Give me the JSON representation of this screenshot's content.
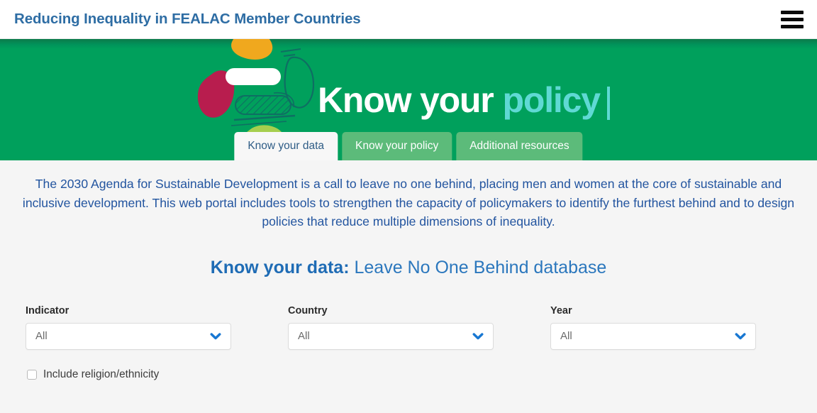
{
  "header": {
    "title": "Reducing Inequality in FEALAC Member Countries",
    "menu_icon": "hamburger-menu-icon"
  },
  "banner": {
    "logo": {
      "word_primary": "Know your",
      "word_accent": "policy",
      "caret": "|"
    },
    "colors": {
      "green": "#00a05c",
      "green_dark": "#0c7a4a",
      "accent_cyan": "#5fd9d4",
      "blob_orange": "#f0a81e",
      "blob_crimson": "#b81d4e",
      "blob_lightgreen": "#a6ce4e",
      "blob_white": "#ffffff",
      "blob_teal_outline": "#0f6e63"
    }
  },
  "tabs": [
    {
      "label": "Know your data",
      "active": true
    },
    {
      "label": "Know your policy",
      "active": false
    },
    {
      "label": "Additional resources",
      "active": false
    }
  ],
  "main": {
    "intro_paragraph": "The 2030 Agenda for Sustainable Development is a call to leave no one behind, placing men and women at the core of sustainable and inclusive development. This web portal includes tools to strengthen the capacity of policymakers to identify the furthest behind and to design policies that reduce multiple dimensions of inequality.",
    "section_heading_bold": "Know your data:",
    "section_heading_rest": " Leave No One Behind database",
    "filters": [
      {
        "label": "Indicator",
        "value": "All",
        "icon": "chevron-down-icon"
      },
      {
        "label": "Country",
        "value": "All",
        "icon": "chevron-down-icon"
      },
      {
        "label": "Year",
        "value": "All",
        "icon": "chevron-down-icon"
      }
    ],
    "checkbox": {
      "label": "Include religion/ethnicity",
      "checked": false
    }
  }
}
